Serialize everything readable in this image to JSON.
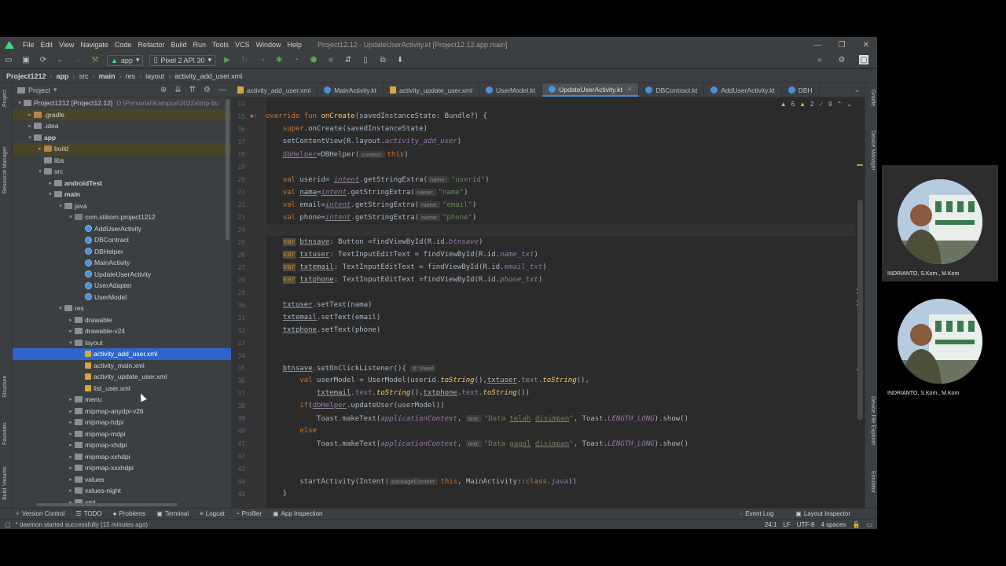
{
  "menu": [
    "File",
    "Edit",
    "View",
    "Navigate",
    "Code",
    "Refactor",
    "Build",
    "Run",
    "Tools",
    "VCS",
    "Window",
    "Help"
  ],
  "window_title": "Project12.12 - UpdateUserActivity.kt [Project12.12.app.main]",
  "toolbar": {
    "module": "app",
    "device": "Pixel 2 API 30"
  },
  "breadcrumb": [
    "Project1212",
    "app",
    "src",
    "main",
    "res",
    "layout",
    "activity_add_user.xml"
  ],
  "left_strip": [
    "Project",
    "Resource Manager",
    "Structure",
    "Favorites",
    "Build Variants"
  ],
  "right_strip": [
    "Gradle",
    "Device Manager",
    "Device File Explorer",
    "Emulator"
  ],
  "project_panel": {
    "title": "Project",
    "tree": [
      {
        "indent": 0,
        "arrow": "▾",
        "icon": "folder",
        "label": "Project1212 [Project12.12]",
        "hint": "D:\\Personal\\Kampus\\2022a\\mp-bu"
      },
      {
        "indent": 1,
        "arrow": "▸",
        "icon": "ofolder",
        "label": ".gradle",
        "hl": true
      },
      {
        "indent": 1,
        "arrow": "▸",
        "icon": "folder",
        "label": ".idea"
      },
      {
        "indent": 1,
        "arrow": "▾",
        "icon": "folder",
        "label": "app",
        "bold": true
      },
      {
        "indent": 2,
        "arrow": "▸",
        "icon": "ofolder",
        "label": "build",
        "hl": true
      },
      {
        "indent": 2,
        "arrow": "",
        "icon": "folder",
        "label": "libs"
      },
      {
        "indent": 2,
        "arrow": "▾",
        "icon": "folder",
        "label": "src"
      },
      {
        "indent": 3,
        "arrow": "▸",
        "icon": "folder",
        "label": "androidTest",
        "bold": true
      },
      {
        "indent": 3,
        "arrow": "▾",
        "icon": "folder",
        "label": "main",
        "bold": true
      },
      {
        "indent": 4,
        "arrow": "▾",
        "icon": "folder",
        "label": "java"
      },
      {
        "indent": 5,
        "arrow": "▾",
        "icon": "pkg",
        "label": "com.stikom.project1212"
      },
      {
        "indent": 6,
        "arrow": "",
        "icon": "kt",
        "label": "AddUserActivity"
      },
      {
        "indent": 6,
        "arrow": "",
        "icon": "kt",
        "label": "DBContract"
      },
      {
        "indent": 6,
        "arrow": "",
        "icon": "kt",
        "label": "DBHelper"
      },
      {
        "indent": 6,
        "arrow": "",
        "icon": "kt",
        "label": "MainActivity"
      },
      {
        "indent": 6,
        "arrow": "",
        "icon": "kt",
        "label": "UpdateUserActivity"
      },
      {
        "indent": 6,
        "arrow": "",
        "icon": "kt",
        "label": "UserAdapter"
      },
      {
        "indent": 6,
        "arrow": "",
        "icon": "kt",
        "label": "UserModel"
      },
      {
        "indent": 4,
        "arrow": "▾",
        "icon": "folder",
        "label": "res"
      },
      {
        "indent": 5,
        "arrow": "▸",
        "icon": "folder",
        "label": "drawable"
      },
      {
        "indent": 5,
        "arrow": "▸",
        "icon": "folder",
        "label": "drawable-v24"
      },
      {
        "indent": 5,
        "arrow": "▾",
        "icon": "folder",
        "label": "layout"
      },
      {
        "indent": 6,
        "arrow": "",
        "icon": "xml",
        "label": "activity_add_user.xml",
        "sel": true
      },
      {
        "indent": 6,
        "arrow": "",
        "icon": "xml",
        "label": "activity_main.xml"
      },
      {
        "indent": 6,
        "arrow": "",
        "icon": "xml",
        "label": "activity_update_user.xml"
      },
      {
        "indent": 6,
        "arrow": "",
        "icon": "xml",
        "label": "list_user.xml"
      },
      {
        "indent": 5,
        "arrow": "▸",
        "icon": "folder",
        "label": "menu"
      },
      {
        "indent": 5,
        "arrow": "▸",
        "icon": "folder",
        "label": "mipmap-anydpi-v26"
      },
      {
        "indent": 5,
        "arrow": "▸",
        "icon": "folder",
        "label": "mipmap-hdpi"
      },
      {
        "indent": 5,
        "arrow": "▸",
        "icon": "folder",
        "label": "mipmap-mdpi"
      },
      {
        "indent": 5,
        "arrow": "▸",
        "icon": "folder",
        "label": "mipmap-xhdpi"
      },
      {
        "indent": 5,
        "arrow": "▸",
        "icon": "folder",
        "label": "mipmap-xxhdpi"
      },
      {
        "indent": 5,
        "arrow": "▸",
        "icon": "folder",
        "label": "mipmap-xxxhdpi"
      },
      {
        "indent": 5,
        "arrow": "▸",
        "icon": "folder",
        "label": "values"
      },
      {
        "indent": 5,
        "arrow": "▸",
        "icon": "folder",
        "label": "values-night"
      },
      {
        "indent": 5,
        "arrow": "▸",
        "icon": "folder",
        "label": "xml"
      }
    ]
  },
  "tabs": [
    {
      "label": "activity_add_user.xml",
      "icon": "xml"
    },
    {
      "label": "MainActivity.kt",
      "icon": "kt"
    },
    {
      "label": "activity_update_user.xml",
      "icon": "xml"
    },
    {
      "label": "UserModel.kt",
      "icon": "kt"
    },
    {
      "label": "UpdateUserActivity.kt",
      "icon": "kt",
      "active": true
    },
    {
      "label": "DBContract.kt",
      "icon": "kt"
    },
    {
      "label": "AddUserActivity.kt",
      "icon": "kt"
    },
    {
      "label": "DBH",
      "icon": "kt"
    }
  ],
  "inspection": {
    "warnings": "6",
    "weak": "2",
    "typos": "9"
  },
  "code_lines": [
    {
      "n": "14",
      "html": ""
    },
    {
      "n": "15",
      "html": "<span class='kw'>override fun </span><span class='fn'>onCreate</span>(savedInstanceState: Bundle?) {"
    },
    {
      "n": "16",
      "html": "    <span class='kw'>super</span>.onCreate(savedInstanceState)"
    },
    {
      "n": "17",
      "html": "    setContentView(R.layout.<span class='it'>activity_add_user</span>)"
    },
    {
      "n": "18",
      "html": "    <span class='prop ul'>dbHelper</span>=DBHelper(<span class='inlay'>context:</span><span class='kw'>this</span>)"
    },
    {
      "n": "19",
      "html": ""
    },
    {
      "n": "20",
      "html": "    <span class='kw'>val </span>userid= <span class='it ul'>intent</span>.getStringExtra(<span class='inlay'>name:</span><span class='str'>\"userid\"</span>)"
    },
    {
      "n": "21",
      "html": "    <span class='kw'>val </span><span class='ul'>nama</span>=<span class='it ul'>intent</span>.getStringExtra(<span class='inlay'>name:</span><span class='str'>\"name\"</span>)"
    },
    {
      "n": "22",
      "html": "    <span class='kw'>val </span>email=<span class='it ul'>intent</span>.getStringExtra(<span class='inlay'>name:</span><span class='str'>\"email\"</span>)"
    },
    {
      "n": "23",
      "html": "    <span class='kw'>val </span>phone=<span class='it ul'>intent</span>.getStringExtra(<span class='inlay'>name:</span><span class='str'>\"phone\"</span>)"
    },
    {
      "n": "24",
      "html": "",
      "cur": true
    },
    {
      "n": "25",
      "html": "    <span class='kw var-bg'>var</span> <span class='ul'>btnsave</span>: Button =findViewById(R.id.<span class='it'>btnsave</span>)"
    },
    {
      "n": "26",
      "html": "    <span class='kw var-bg'>var</span> <span class='ul'>txtuser</span>: TextInputEditText = findViewById(R.id.<span class='it'>name_txt</span>)"
    },
    {
      "n": "27",
      "html": "    <span class='kw var-bg'>var</span> <span class='ul'>txtemail</span>: TextInputEditText = findViewById(R.id.<span class='it'>email_txt</span>)"
    },
    {
      "n": "28",
      "html": "    <span class='kw var-bg'>var</span> <span class='ul'>txtphone</span>: TextInputEditText =findViewById(R.id.<span class='it'>phone_txt</span>)"
    },
    {
      "n": "29",
      "html": ""
    },
    {
      "n": "30",
      "html": "    <span class='ul'>txtuser</span>.setText(nama)"
    },
    {
      "n": "31",
      "html": "    <span class='ul'>txtemail</span>.setText(email)"
    },
    {
      "n": "32",
      "html": "    <span class='ul'>txtphone</span>.setText(phone)"
    },
    {
      "n": "33",
      "html": ""
    },
    {
      "n": "34",
      "html": ""
    },
    {
      "n": "35",
      "html": "    <span class='ul'>btnsave</span>.setOnClickListener(){ <span class='inlay'>it: View!</span>"
    },
    {
      "n": "36",
      "html": "        <span class='kw'>val </span>userModel = UserModel(userid.<span class='itf'>toString</span>(),<span class='ul'>txtuser</span>.<span class='prop'>text</span>.<span class='itf'>toString</span>(),"
    },
    {
      "n": "37",
      "html": "            <span class='ul'>txtemail</span>.<span class='prop'>text</span>.<span class='itf'>toString</span>(),<span class='ul'>txtphone</span>.<span class='prop'>text</span>.<span class='itf'>toString</span>())"
    },
    {
      "n": "38",
      "html": "        <span class='kw'>if</span>(<span class='prop ul'>dbHelper</span>.updateUser(userModel))"
    },
    {
      "n": "39",
      "html": "            Toast.makeText(<span class='it'>applicationContext</span>, <span class='inlay'>text:</span><span class='str'>\"Data <span class='ul'>telah</span> <span class='ul'>disimpan</span>\"</span>, Toast.<span class='it'>LENGTH_LONG</span>).show()"
    },
    {
      "n": "40",
      "html": "        <span class='kw'>else</span>"
    },
    {
      "n": "41",
      "html": "            Toast.makeText(<span class='it'>applicationContext</span>, <span class='inlay'>text:</span><span class='str'>\"Data <span class='ul'>gagal</span> <span class='ul'>disimpan</span>\"</span>, Toast.<span class='it'>LENGTH_LONG</span>).show()"
    },
    {
      "n": "42",
      "html": ""
    },
    {
      "n": "43",
      "html": ""
    },
    {
      "n": "44",
      "html": "        startActivity(Intent(<span class='inlay'>packageContext:</span><span class='kw'>this</span>, MainActivity::<span class='kw'>class</span>.<span class='it'>java</span>))"
    },
    {
      "n": "45",
      "html": "    }"
    }
  ],
  "bottom_tools": [
    "Version Control",
    "TODO",
    "Problems",
    "Terminal",
    "Logcat",
    "Profiler",
    "App Inspection"
  ],
  "bottom_right": [
    "Event Log",
    "Layout Inspector"
  ],
  "status": {
    "message": "* daemon started successfully (15 minutes ago)",
    "position": "24:1",
    "line_sep": "LF",
    "encoding": "UTF-8",
    "indent": "4 spaces"
  },
  "participants": [
    {
      "name": "INDRIANTO, S.Kom., M.Kom"
    },
    {
      "name": "INDRIANTO, S.Kom., M.Kom"
    }
  ]
}
